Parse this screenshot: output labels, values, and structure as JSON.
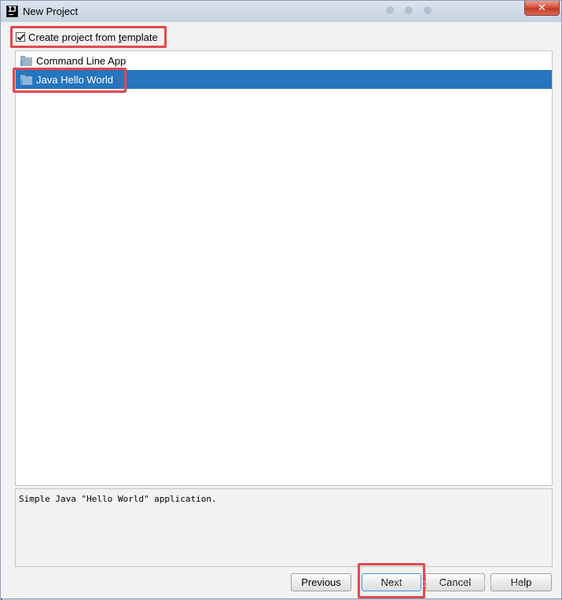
{
  "window": {
    "title": "New Project",
    "icon_text": "IJ",
    "close_symbol": "✕"
  },
  "template_checkbox": {
    "label_before": "Create project from ",
    "label_underlined": "t",
    "label_after": "emplate",
    "checked": true
  },
  "templates": {
    "items": [
      {
        "label": "Command Line App",
        "icon": "folder-icon",
        "selected": false
      },
      {
        "label": "Java Hello World",
        "icon": "folder-icon",
        "selected": true
      }
    ]
  },
  "description": {
    "text": "Simple Java \"Hello World\" application."
  },
  "buttons": {
    "previous": "Previous",
    "next": "Next",
    "cancel": "Cancel",
    "help": "Help"
  },
  "watermark": {
    "text": "https://blog.csdn.net/zoyoto_more"
  },
  "colors": {
    "selection": "#2675bf",
    "highlight_box": "#e2484d",
    "close_button": "#c23a23"
  }
}
